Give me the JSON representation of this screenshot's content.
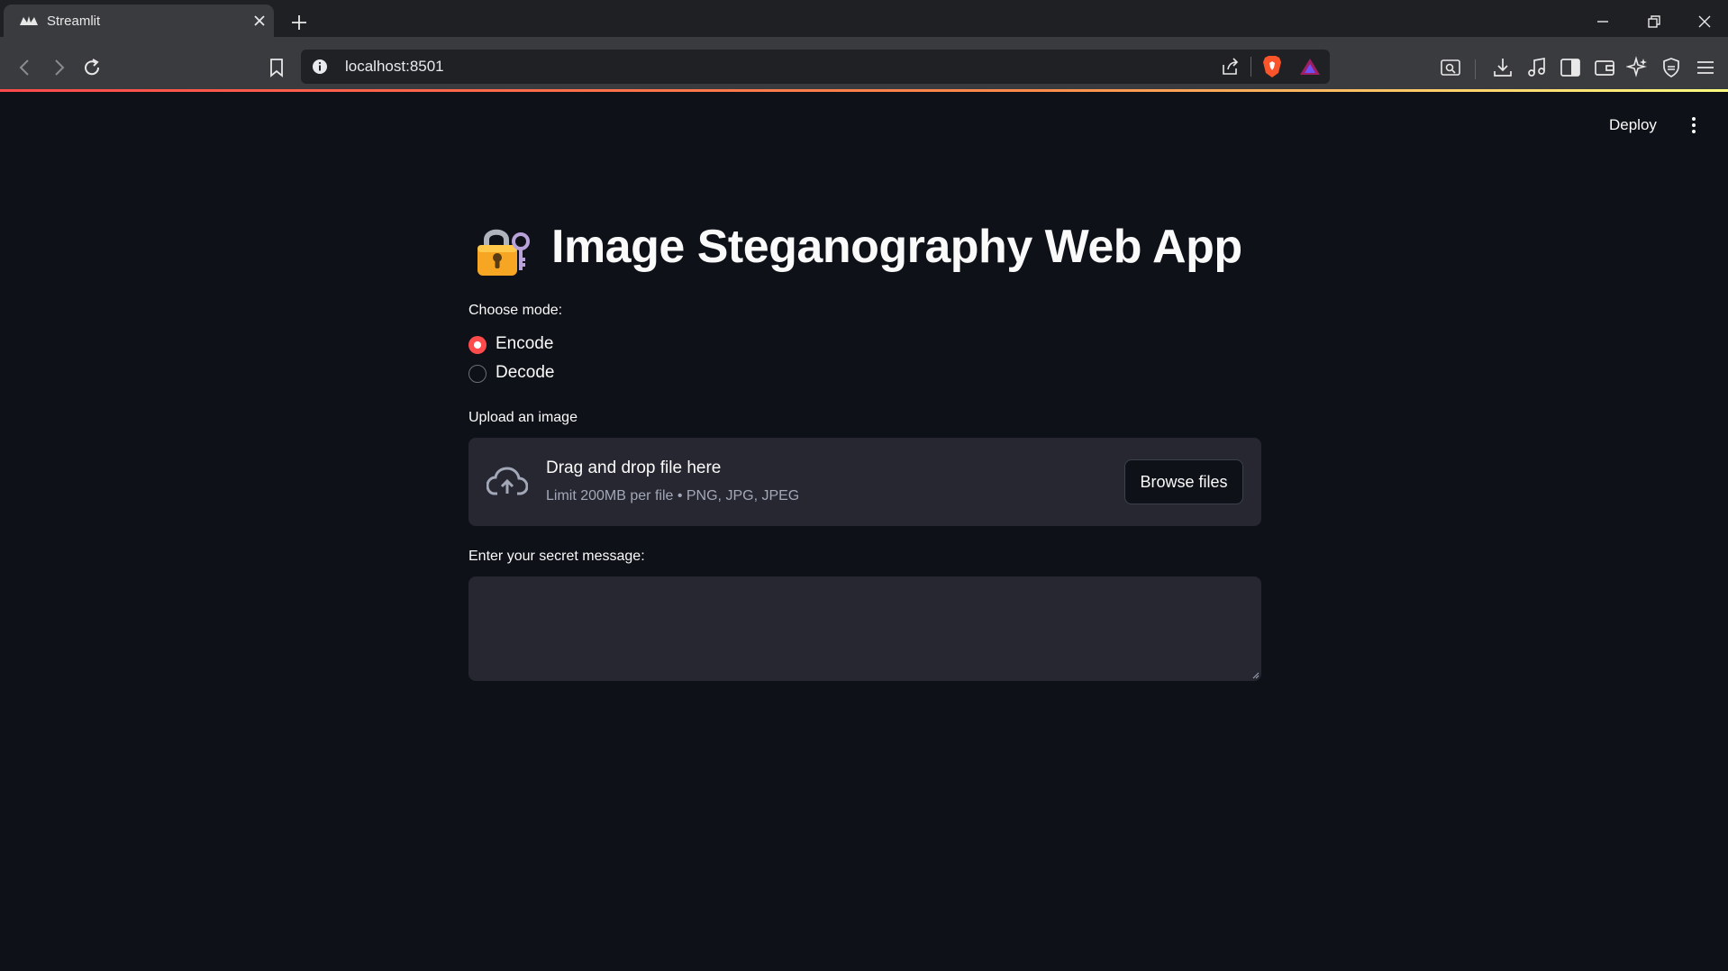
{
  "browser": {
    "tab_title": "Streamlit",
    "url": "localhost:8501"
  },
  "app": {
    "deploy_label": "Deploy",
    "title": "Image Steganography Web App",
    "mode_label": "Choose mode:",
    "modes": [
      {
        "label": "Encode",
        "selected": true
      },
      {
        "label": "Decode",
        "selected": false
      }
    ],
    "upload_label": "Upload an image",
    "dropzone_title": "Drag and drop file here",
    "dropzone_limit": "Limit 200MB per file • PNG, JPG, JPEG",
    "browse_label": "Browse files",
    "message_label": "Enter your secret message:",
    "message_value": ""
  },
  "colors": {
    "accent": "#ff4b4b",
    "background": "#0e1117",
    "widget_bg": "#262730"
  }
}
